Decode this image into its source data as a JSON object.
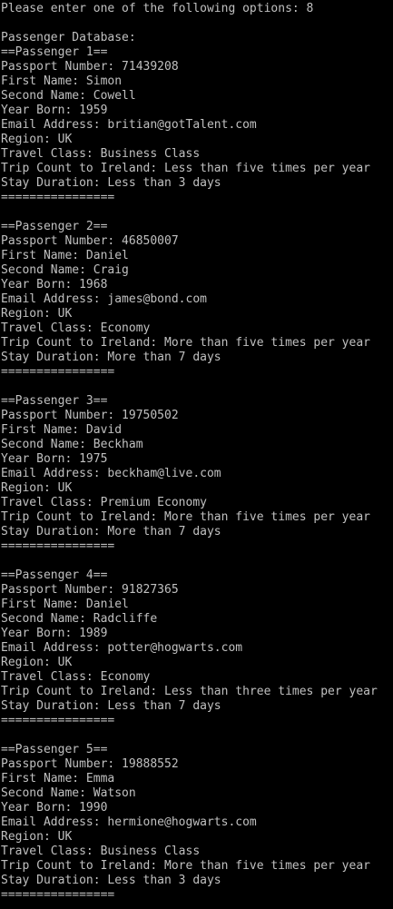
{
  "prompt": "Please enter one of the following options: 8",
  "database_title": "Passenger Database:",
  "separator": "================",
  "passengers": [
    {
      "header": "==Passenger 1==",
      "passport": "Passport Number: 71439208",
      "first_name": "First Name: Simon",
      "second_name": "Second Name: Cowell",
      "year_born": "Year Born: 1959",
      "email": "Email Address: britian@gotTalent.com",
      "region": "Region: UK",
      "travel_class": "Travel Class: Business Class",
      "trip_count": "Trip Count to Ireland: Less than five times per year",
      "stay_duration": "Stay Duration: Less than 3 days"
    },
    {
      "header": "==Passenger 2==",
      "passport": "Passport Number: 46850007",
      "first_name": "First Name: Daniel",
      "second_name": "Second Name: Craig",
      "year_born": "Year Born: 1968",
      "email": "Email Address: james@bond.com",
      "region": "Region: UK",
      "travel_class": "Travel Class: Economy",
      "trip_count": "Trip Count to Ireland: More than five times per year",
      "stay_duration": "Stay Duration: More than 7 days"
    },
    {
      "header": "==Passenger 3==",
      "passport": "Passport Number: 19750502",
      "first_name": "First Name: David",
      "second_name": "Second Name: Beckham",
      "year_born": "Year Born: 1975",
      "email": "Email Address: beckham@live.com",
      "region": "Region: UK",
      "travel_class": "Travel Class: Premium Economy",
      "trip_count": "Trip Count to Ireland: More than five times per year",
      "stay_duration": "Stay Duration: More than 7 days"
    },
    {
      "header": "==Passenger 4==",
      "passport": "Passport Number: 91827365",
      "first_name": "First Name: Daniel",
      "second_name": "Second Name: Radcliffe",
      "year_born": "Year Born: 1989",
      "email": "Email Address: potter@hogwarts.com",
      "region": "Region: UK",
      "travel_class": "Travel Class: Economy",
      "trip_count": "Trip Count to Ireland: Less than three times per year",
      "stay_duration": "Stay Duration: Less than 7 days"
    },
    {
      "header": "==Passenger 5==",
      "passport": "Passport Number: 19888552",
      "first_name": "First Name: Emma",
      "second_name": "Second Name: Watson",
      "year_born": "Year Born: 1990",
      "email": "Email Address: hermione@hogwarts.com",
      "region": "Region: UK",
      "travel_class": "Travel Class: Business Class",
      "trip_count": "Trip Count to Ireland: More than five times per year",
      "stay_duration": "Stay Duration: Less than 3 days"
    }
  ],
  "colors": {
    "background": "#000000",
    "text": "#c0c0c0"
  }
}
